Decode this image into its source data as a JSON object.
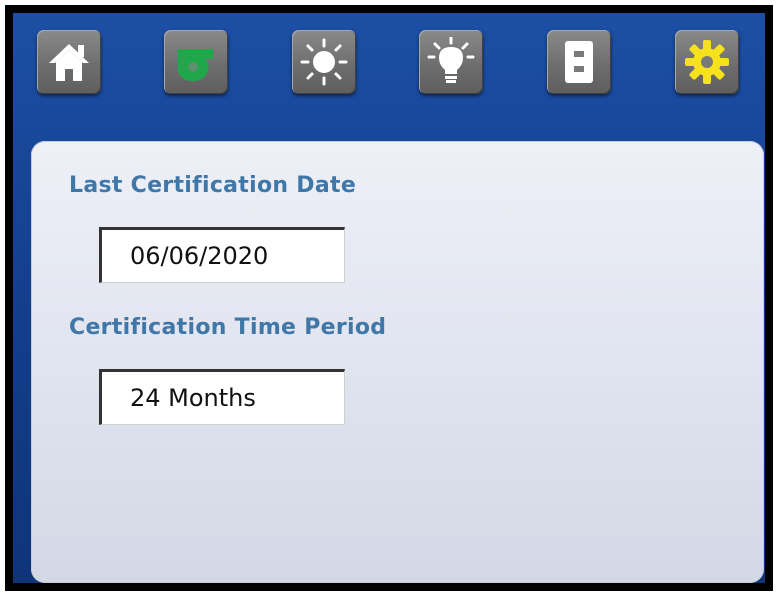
{
  "toolbar": {
    "buttons": [
      {
        "icon": "home-icon"
      },
      {
        "icon": "fan-blower-icon",
        "color": "#1fa84a"
      },
      {
        "icon": "sun-icon"
      },
      {
        "icon": "light-bulb-icon"
      },
      {
        "icon": "outlet-icon"
      },
      {
        "icon": "gear-icon",
        "color": "#f5e21c"
      }
    ]
  },
  "certification": {
    "last_date_label": "Last Certification Date",
    "last_date_value": "06/06/2020",
    "period_label": "Certification Time Period",
    "period_value": "24 Months"
  },
  "colors": {
    "background_blue": "#1a4aa0",
    "label_blue": "#3f77a8",
    "panel": "#e3e6f0"
  }
}
